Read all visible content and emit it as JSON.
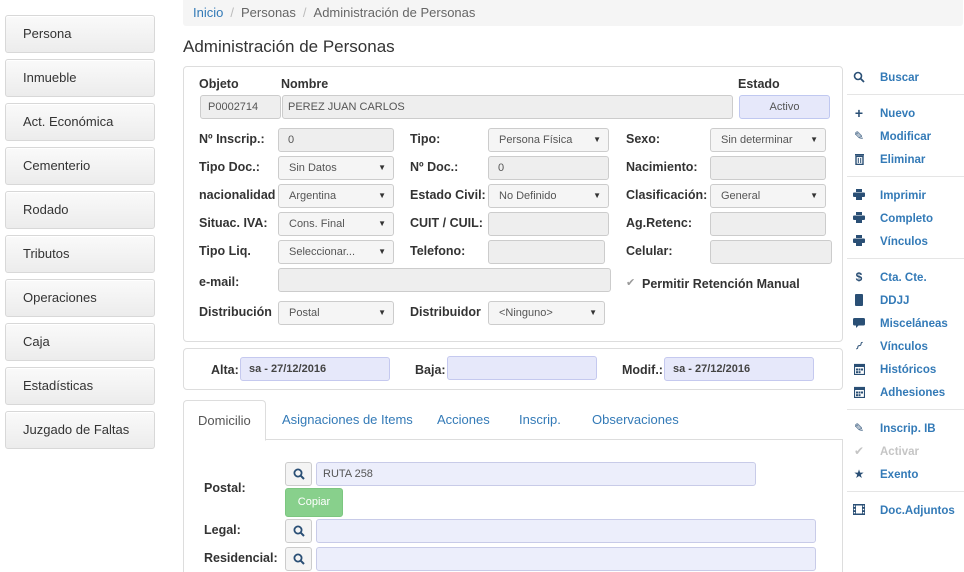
{
  "sidebar": {
    "items": [
      "Persona",
      "Inmueble",
      "Act. Económica",
      "Cementerio",
      "Rodado",
      "Tributos",
      "Operaciones",
      "Caja",
      "Estadísticas",
      "Juzgado de Faltas"
    ]
  },
  "breadcrumb": {
    "home": "Inicio",
    "section": "Personas",
    "current": "Administración de Personas"
  },
  "page_title": "Administración de Personas",
  "header": {
    "objeto_label": "Objeto",
    "objeto_value": "P0002714",
    "nombre_label": "Nombre",
    "nombre_value": "PEREZ JUAN CARLOS",
    "estado_label": "Estado",
    "estado_value": "Activo"
  },
  "form": {
    "ninscrip_label": "Nº Inscrip.:",
    "ninscrip_value": "0",
    "tipo_label": "Tipo:",
    "tipo_value": "Persona Física",
    "sexo_label": "Sexo:",
    "sexo_value": "Sin determinar",
    "tipodoc_label": "Tipo Doc.:",
    "tipodoc_value": "Sin Datos",
    "ndoc_label": "Nº Doc.:",
    "ndoc_value": "0",
    "nacimiento_label": "Nacimiento:",
    "nacimiento_value": "",
    "nacionalidad_label": "nacionalidad",
    "nacionalidad_value": "Argentina",
    "estadocivil_label": "Estado Civil:",
    "estadocivil_value": "No Definido",
    "clasificacion_label": "Clasificación:",
    "clasificacion_value": "General",
    "situaciva_label": "Situac. IVA:",
    "situaciva_value": "Cons. Final",
    "cuit_label": "CUIT / CUIL:",
    "cuit_value": "",
    "agretenc_label": "Ag.Retenc:",
    "agretenc_value": "",
    "tipoliq_label": "Tipo Liq.",
    "tipoliq_value": "Seleccionar...",
    "telefono_label": "Telefono:",
    "telefono_value": "",
    "celular_label": "Celular:",
    "celular_value": "",
    "email_label": "e-mail:",
    "email_value": "",
    "permitir_label": "Permitir Retención Manual",
    "permitir_checked": true,
    "distribucion_label": "Distribución",
    "distribucion_value": "Postal",
    "distribuidor_label": "Distribuidor",
    "distribuidor_value": "<Ninguno>"
  },
  "dates": {
    "alta_label": "Alta:",
    "alta_value": "sa - 27/12/2016",
    "baja_label": "Baja:",
    "baja_value": "",
    "modif_label": "Modif.:",
    "modif_value": "sa - 27/12/2016"
  },
  "tabs": [
    "Domicilio",
    "Asignaciones de Items",
    "Acciones",
    "Inscrip.",
    "Observaciones"
  ],
  "domicilio": {
    "postal_label": "Postal:",
    "postal_value": "RUTA 258",
    "copiar_label": "Copiar",
    "legal_label": "Legal:",
    "legal_value": "",
    "residencial_label": "Residencial:",
    "residencial_value": ""
  },
  "actions": [
    {
      "label": "Buscar",
      "icon": "search-icon"
    },
    {
      "label": "Nuevo",
      "icon": "plus-icon"
    },
    {
      "label": "Modificar",
      "icon": "pencil-icon"
    },
    {
      "label": "Eliminar",
      "icon": "trash-icon"
    },
    {
      "label": "Imprimir",
      "icon": "print-icon"
    },
    {
      "label": "Completo",
      "icon": "print-icon"
    },
    {
      "label": "Vínculos",
      "icon": "print-icon"
    },
    {
      "label": "Cta. Cte.",
      "icon": "dollar-icon"
    },
    {
      "label": "DDJJ",
      "icon": "book-icon"
    },
    {
      "label": "Misceláneas",
      "icon": "comment-icon"
    },
    {
      "label": "Vínculos",
      "icon": "paperclip-icon"
    },
    {
      "label": "Históricos",
      "icon": "calendar-icon"
    },
    {
      "label": "Adhesiones",
      "icon": "calendar-icon"
    },
    {
      "label": "Inscrip. IB",
      "icon": "pencil-icon"
    },
    {
      "label": "Activar",
      "icon": "check-icon",
      "disabled": true
    },
    {
      "label": "Exento",
      "icon": "star-icon"
    },
    {
      "label": "Doc.Adjuntos",
      "icon": "film-icon"
    }
  ]
}
